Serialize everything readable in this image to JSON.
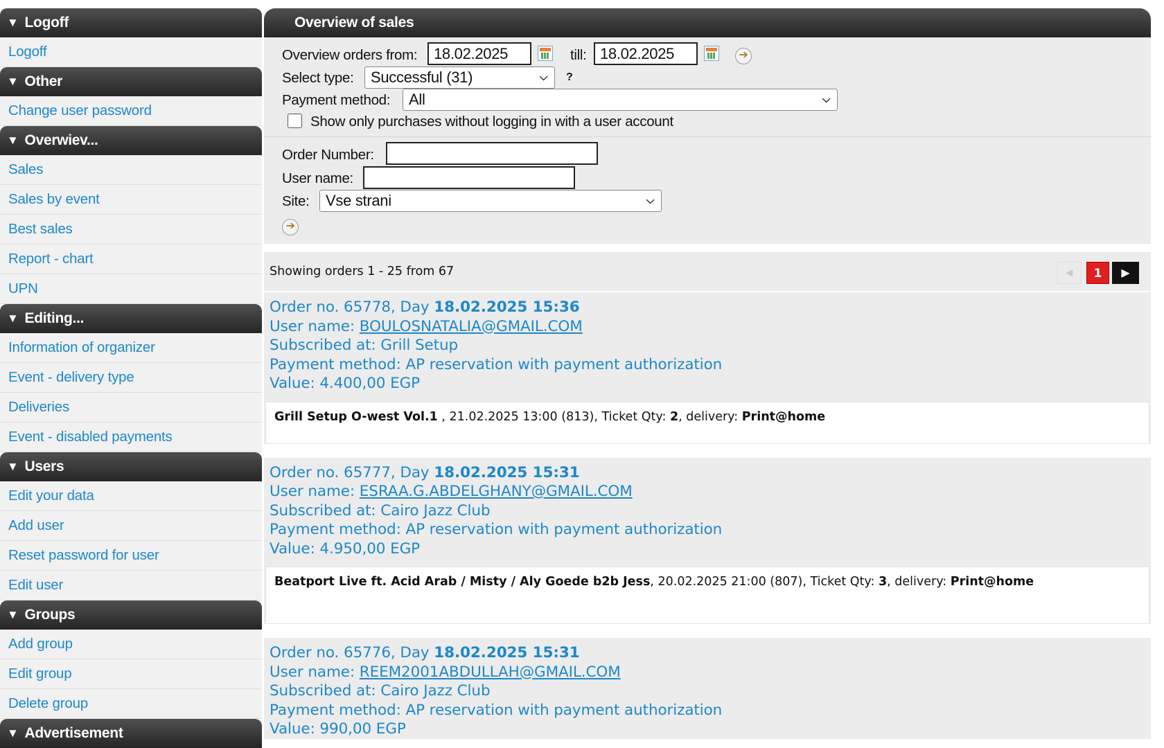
{
  "sidebar": {
    "sections": [
      {
        "title": "Logoff",
        "items": [
          "Logoff"
        ]
      },
      {
        "title": "Other",
        "items": [
          "Change user password"
        ]
      },
      {
        "title": "Overwiev...",
        "items": [
          "Sales",
          "Sales by event",
          "Best sales",
          "Report - chart",
          "UPN"
        ]
      },
      {
        "title": "Editing...",
        "items": [
          "Information of organizer",
          "Event - delivery type",
          "Deliveries",
          "Event - disabled payments"
        ]
      },
      {
        "title": "Users",
        "items": [
          "Edit your data",
          "Add user",
          "Reset password for user",
          "Edit user"
        ]
      },
      {
        "title": "Groups",
        "items": [
          "Add group",
          "Edit group",
          "Delete group"
        ]
      },
      {
        "title": "Advertisement",
        "items": []
      }
    ]
  },
  "main": {
    "title": "Overview of sales",
    "filters": {
      "from_label": "Overview orders from:",
      "from_value": "18.02.2025",
      "till_label": "till:",
      "till_value": "18.02.2025",
      "type_label": "Select type:",
      "type_value": "Successful (31)",
      "help_mark": "?",
      "payment_label": "Payment method:",
      "payment_value": "All",
      "checkbox_label": "Show only purchases without logging in with a user account",
      "checkbox_checked": false,
      "order_number_label": "Order Number:",
      "order_number_value": "",
      "user_name_label": "User name:",
      "user_name_value": "",
      "site_label": "Site:",
      "site_value": "Vse strani"
    },
    "summary": "Showing orders 1 - 25 from 67",
    "pager": {
      "prev": "◀",
      "current": "1",
      "next": "▶"
    },
    "orders": [
      {
        "order_prefix": "Order no. 65778, Day ",
        "datetime": "18.02.2025 15:36",
        "user_prefix": "User name: ",
        "user": "BOULOSNATALIA@GMAIL.COM",
        "subscribed": "Subscribed at: Grill Setup",
        "payment": "Payment method: AP reservation with payment authorization",
        "value": "Value: 4.400,00 EGP",
        "event": "Grill Setup O-west Vol.1",
        "event_info": " , 21.02.2025 13:00 (813), Ticket Qty: ",
        "qty": "2",
        "delivery_label": ", delivery: ",
        "delivery": "Print@home"
      },
      {
        "order_prefix": "Order no. 65777, Day ",
        "datetime": "18.02.2025 15:31",
        "user_prefix": "User name: ",
        "user": "ESRAA.G.ABDELGHANY@GMAIL.COM",
        "subscribed": "Subscribed at: Cairo Jazz Club",
        "payment": "Payment method: AP reservation with payment authorization",
        "value": "Value: 4.950,00 EGP",
        "event": "Beatport Live ft. Acid Arab / Misty / Aly Goede b2b Jess",
        "event_info": ", 20.02.2025 21:00 (807), Ticket Qty: ",
        "qty": "3",
        "delivery_label": ", delivery: ",
        "delivery": "Print@home"
      },
      {
        "order_prefix": "Order no. 65776, Day ",
        "datetime": "18.02.2025 15:31",
        "user_prefix": "User name: ",
        "user": "REEM2001ABDULLAH@GMAIL.COM",
        "subscribed": "Subscribed at: Cairo Jazz Club",
        "payment": "Payment method: AP reservation with payment authorization",
        "value": "Value: 990,00 EGP"
      }
    ]
  }
}
